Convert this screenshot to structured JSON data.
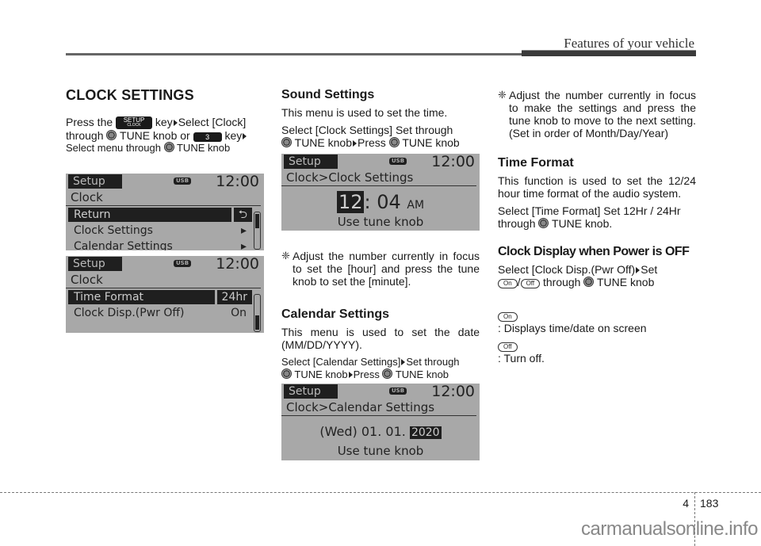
{
  "header": {
    "section_title": "Features of your vehicle"
  },
  "col1": {
    "title": "CLOCK SETTINGS",
    "line1": [
      "Press the",
      "key",
      "Select [Clock]"
    ],
    "line2": [
      "through",
      "TUNE knob or",
      "key"
    ],
    "line3": [
      "Select menu through",
      "TUNE knob"
    ],
    "setup_key": {
      "main": "SETUP",
      "sub": "CLOCK"
    },
    "num_key": "3",
    "screen1": {
      "mode": "Setup",
      "badge": "USB",
      "time": "12:00",
      "title": "Clock",
      "items": [
        {
          "label": "Return",
          "value": "⮌",
          "selected": true
        },
        {
          "label": "Clock Settings",
          "value": "▸",
          "selected": false
        },
        {
          "label": "Calendar Settings",
          "value": "▸",
          "selected": false
        }
      ]
    },
    "screen2": {
      "mode": "Setup",
      "badge": "USB",
      "time": "12:00",
      "title": "Clock",
      "items": [
        {
          "label": "Time Format",
          "value": "24hr",
          "selected": true
        },
        {
          "label": "Clock Disp.(Pwr Off)",
          "value": "On",
          "selected": false
        }
      ]
    }
  },
  "col2": {
    "sound": {
      "title": "Sound Settings",
      "desc": "This menu is used to set the time.",
      "instr1": "Select [Clock Settings] Set through",
      "instr2a": "TUNE knob",
      "instr2b": "Press",
      "instr2c": "TUNE knob"
    },
    "screen3": {
      "mode": "Setup",
      "badge": "USB",
      "time": "12:00",
      "title": "Clock>Clock Settings",
      "hour": "12",
      "sep": ":",
      "minute": "04",
      "ampm": "AM",
      "hint": "Use tune knob"
    },
    "note1": {
      "mark": "❈",
      "text": "Adjust the number currently in focus to set the [hour] and press the tune knob to set the [minute]."
    },
    "calendar": {
      "title": "Calendar Settings",
      "desc": "This menu is used to set the date (MM/DD/YYYY).",
      "instr1": "Select [Calendar Settings]",
      "instr1b": "Set through",
      "instr2a": "TUNE knob",
      "instr2b": "Press",
      "instr2c": "TUNE knob"
    },
    "screen4": {
      "mode": "Setup",
      "badge": "USB",
      "time": "12:00",
      "title": "Clock>Calendar Settings",
      "date_prefix": "(Wed) 01. 01.",
      "year": "2020",
      "hint": "Use tune knob"
    }
  },
  "col3": {
    "note2": {
      "mark": "❈",
      "text": "Adjust the number currently in focus to make the settings and press the tune knob to move to the next setting. (Set in order of Month/Day/Year)"
    },
    "time_format": {
      "title": "Time Format",
      "desc": "This function is used to set the 12/24 hour time format of the audio system.",
      "instr1": "Select [Time Format] Set 12Hr / 24Hr",
      "instr2a": "through",
      "instr2b": "TUNE knob."
    },
    "clock_display": {
      "title": "Clock Display when Power is OFF",
      "instr1a": "Select [Clock Disp.(Pwr Off)",
      "instr1b": "Set",
      "on_label": "On",
      "off_label": "Off",
      "slash": "/",
      "instr2": "through",
      "instr2b": "TUNE knob",
      "on_desc": ": Displays time/date on screen",
      "off_desc": ": Turn off."
    }
  },
  "footer": {
    "chapter": "4",
    "page": "183",
    "watermark": "carmanualsonline.info"
  }
}
